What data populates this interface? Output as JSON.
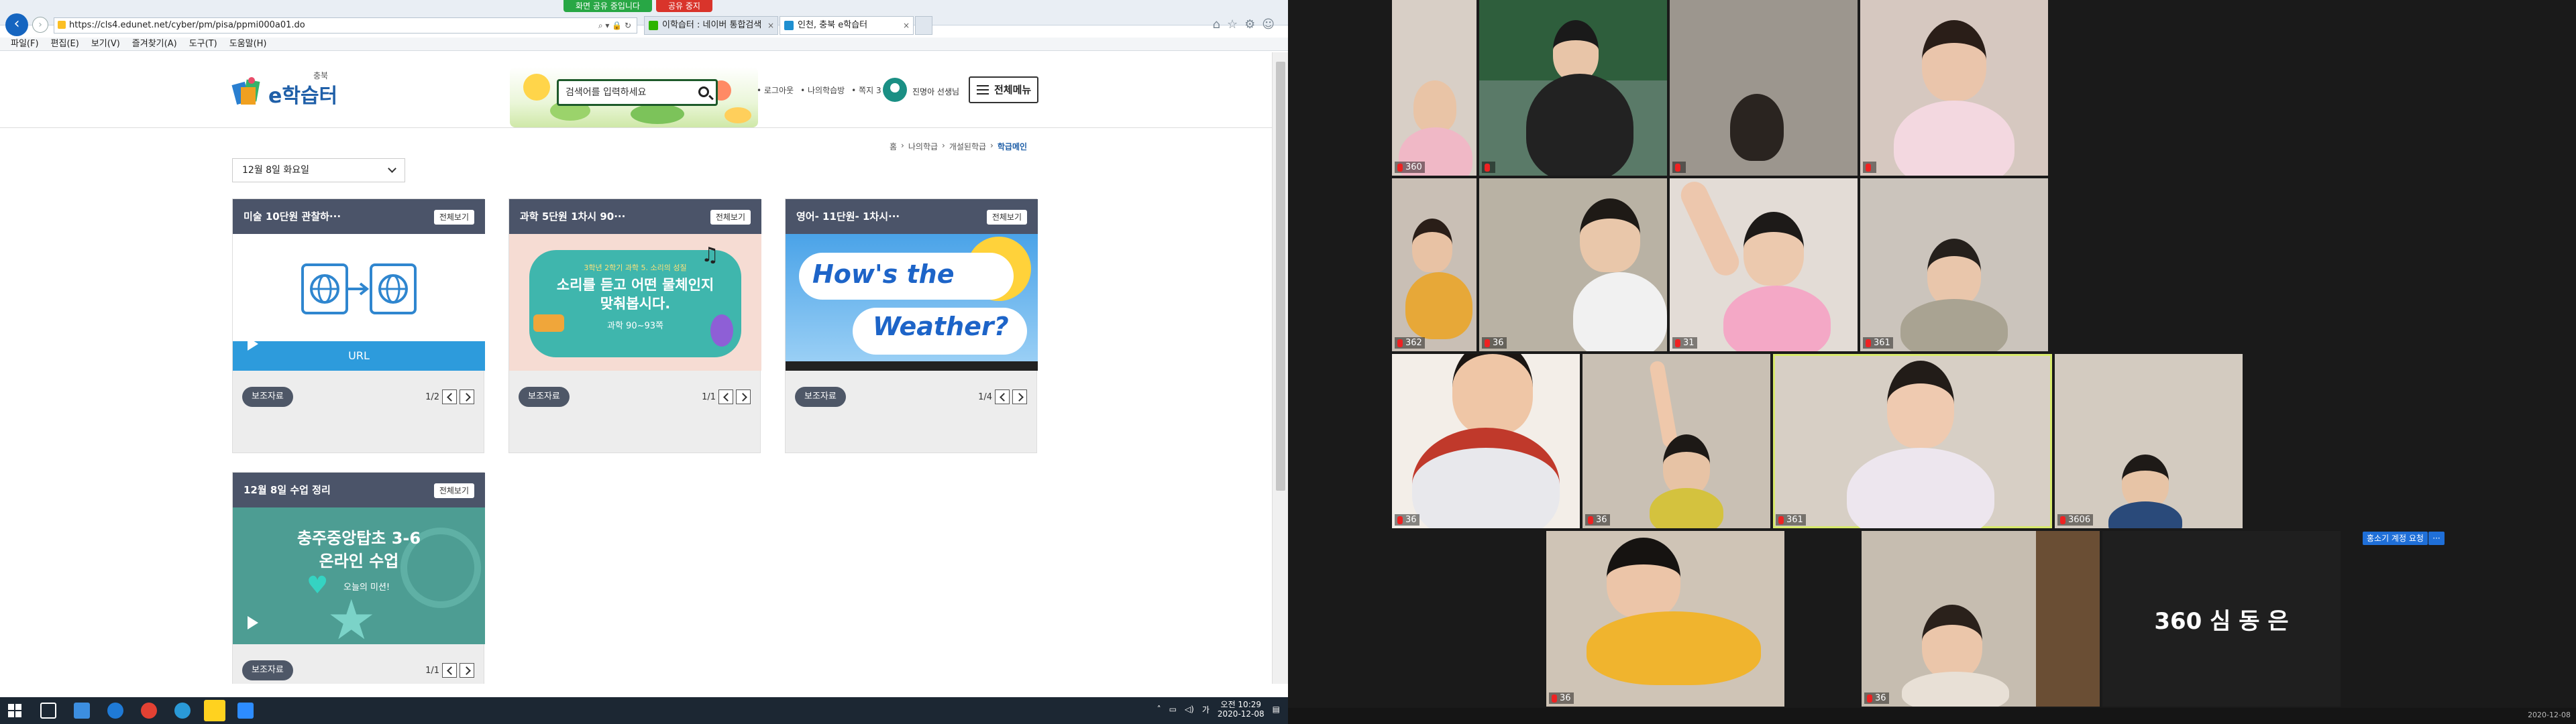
{
  "share_bar": {
    "status": "화면 공유 중입니다",
    "stop": "공유 중지"
  },
  "browser": {
    "url": "https://cls4.edunet.net/cyber/pm/pisa/ppmi000a01.do",
    "tabs": [
      {
        "label": "이학습터 : 네이버 통합검색",
        "active": false
      },
      {
        "label": "인천, 충북 e학습터",
        "active": true
      }
    ],
    "menu": [
      "파일(F)",
      "편집(E)",
      "보기(V)",
      "즐겨찾기(A)",
      "도구(T)",
      "도움말(H)"
    ]
  },
  "site": {
    "logo_small": "충북",
    "logo_big": "e학습터",
    "search_placeholder": "검색어를 입력하세요",
    "top_links": [
      "• 로그아웃",
      "• 나의학습방",
      "• 쪽지 3"
    ],
    "user_name": "진명아 선생님",
    "menu_label": "전체메뉴",
    "breadcrumb": [
      "홈",
      "나의학급",
      "개설된학급",
      "학급메인"
    ],
    "date_select": "12월 8일 화요일"
  },
  "cards": [
    {
      "title": "미술 10단원 관찰하···",
      "view_all": "전체보기",
      "thumb_label": "URL",
      "chip": "보조자료",
      "page": "1/2"
    },
    {
      "title": "과학 5단원 1차시 90···",
      "view_all": "전체보기",
      "thumb_small": "3학년 2학기 과학 5. 소리의 성질",
      "thumb_main": "소리를 듣고 어떤 물체인지 맞춰봅시다.",
      "thumb_sub": "과학 90~93쪽",
      "chip": "보조자료",
      "page": "1/1"
    },
    {
      "title": "영어- 11단원- 1차시···",
      "view_all": "전체보기",
      "thumb_line1": "How's the",
      "thumb_line2": "Weather?",
      "chip": "보조자료",
      "page": "1/4"
    },
    {
      "title": "12월 8일 수업 정리",
      "view_all": "전체보기",
      "thumb_line1": "충주중앙탑초 3-6",
      "thumb_line2": "온라인 수업",
      "thumb_note": "오늘의 미션!",
      "chip": "보조자료",
      "page": "1/1"
    }
  ],
  "taskbar": {
    "time": "오전 10:29",
    "date": "2020-12-08",
    "ime": "가"
  },
  "zoom": {
    "names": [
      "360",
      "",
      "",
      "",
      "362",
      "36",
      "31",
      "361",
      "36",
      "36",
      "361",
      "3606",
      "36",
      "36"
    ],
    "big_name": "360 심 동 은",
    "badge": "홍소기 계정 요청",
    "more": "···",
    "clock": "2020-12-08"
  },
  "colors": {
    "card_header": "#4b5469",
    "accent_blue": "#1f5fa8",
    "url_bar": "#2d9bdc",
    "speaker_outline": "#d7e96b"
  }
}
